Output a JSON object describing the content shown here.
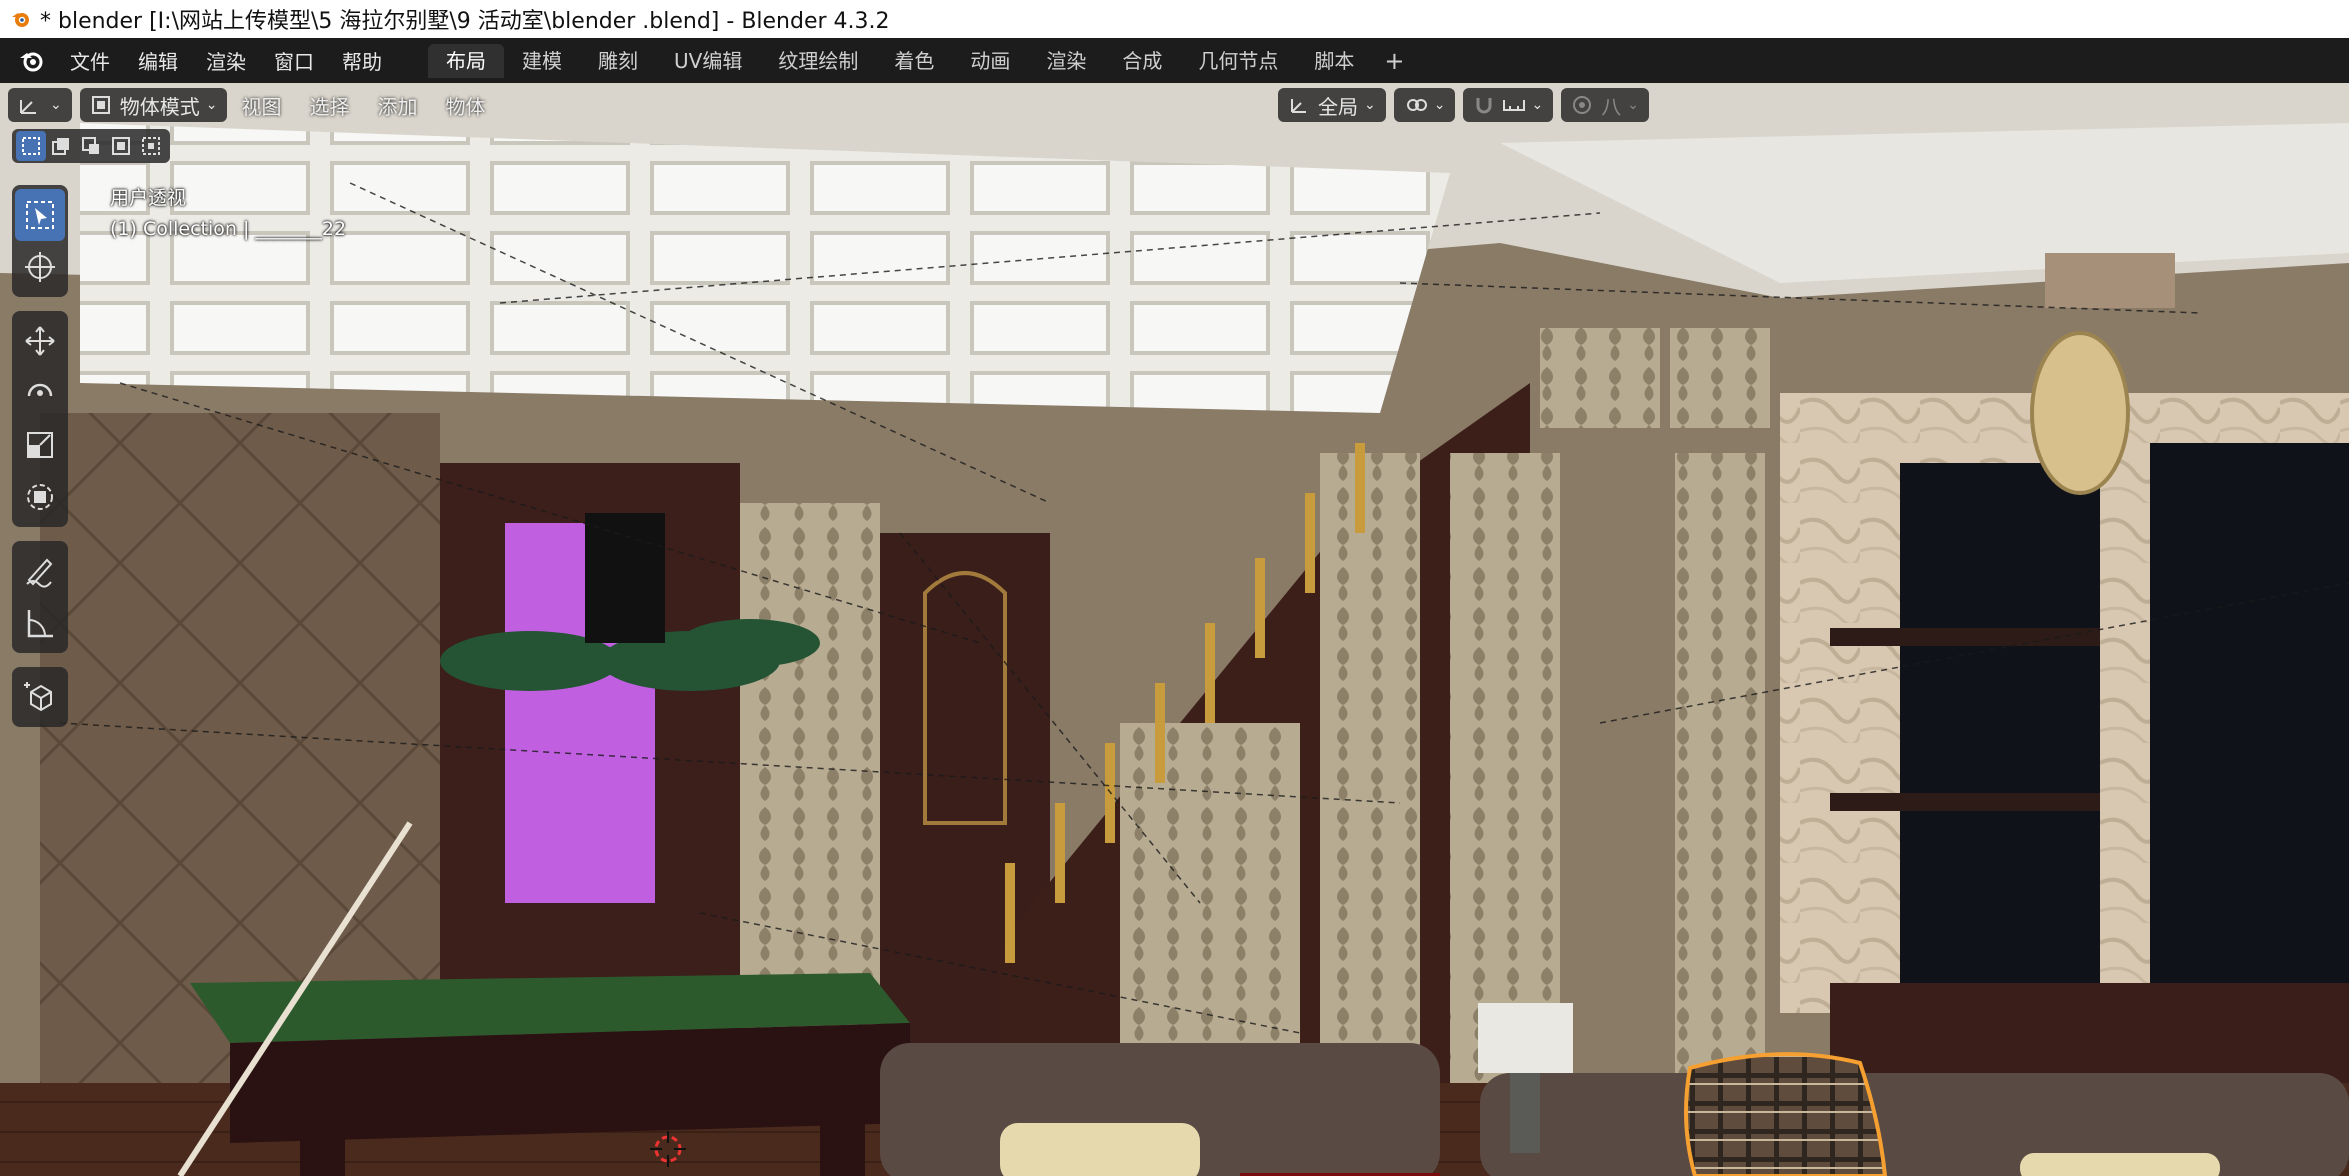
{
  "window": {
    "title": "* blender  [I:\\网站上传模型\\5 海拉尔别墅\\9 活动室\\blender .blend] - Blender 4.3.2"
  },
  "menubar": {
    "menus": [
      "文件",
      "编辑",
      "渲染",
      "窗口",
      "帮助"
    ],
    "workspaces": [
      "布局",
      "建模",
      "雕刻",
      "UV编辑",
      "纹理绘制",
      "着色",
      "动画",
      "渲染",
      "合成",
      "几何节点",
      "脚本"
    ],
    "active_workspace": "布局",
    "add_tab": "+"
  },
  "viewport_header": {
    "editor_type_icon": "transform-gizmo-icon",
    "mode_label": "物体模式",
    "menus": [
      "视图",
      "选择",
      "添加",
      "物体"
    ],
    "orientation_label": "全局",
    "snap_icons": [
      "link-icon",
      "magnet-icon",
      "snap-grid-icon",
      "proportional-icon"
    ],
    "proportional_label": "八"
  },
  "viewport_info": {
    "view_name": "用户透视",
    "collection_line": "(1) Collection | _______22"
  },
  "toolbar": {
    "tools": [
      "select-box-icon",
      "cursor-icon",
      "move-icon",
      "rotate-icon",
      "scale-icon",
      "transform-icon",
      "annotate-icon",
      "measure-icon",
      "add-cube-icon"
    ],
    "active_tool": "select-box-icon"
  },
  "colors": {
    "accent": "#4772b3",
    "selection_outline": "#f5a030",
    "window_glow": "#c060e0"
  }
}
